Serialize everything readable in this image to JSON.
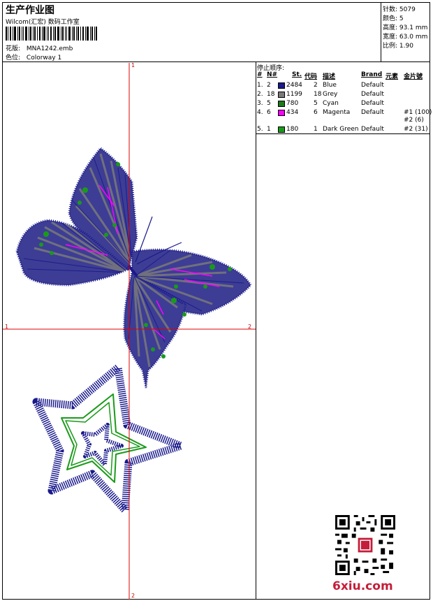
{
  "header": {
    "title": "生产作业图",
    "subtitle": "Wilcom(汇宏) 数码工作室",
    "design_label": "花版:",
    "design_value": "MNA1242.emb",
    "colorway_label": "色位:",
    "colorway_value": "Colorway 1"
  },
  "stats": [
    {
      "label": "针数:",
      "value": "5079"
    },
    {
      "label": "颜色:",
      "value": "5"
    },
    {
      "label": "高度:",
      "value": "93.1 mm"
    },
    {
      "label": "宽度:",
      "value": "63.0 mm"
    },
    {
      "label": "比例:",
      "value": "1.90"
    }
  ],
  "sequence": {
    "title": "停止顺序:",
    "headers": [
      "#",
      "N#",
      "St.",
      "代码",
      "描述",
      "Brand",
      "元素",
      "金片號"
    ],
    "rows": [
      {
        "no": "1.",
        "n": "2",
        "st": "2484",
        "code": "2",
        "desc": "Blue",
        "brand": "Default",
        "elem": "",
        "color": "#1a1a8c"
      },
      {
        "no": "2.",
        "n": "18",
        "st": "1199",
        "code": "18",
        "desc": "Grey",
        "brand": "Default",
        "elem": "",
        "color": "#7a7a7a"
      },
      {
        "no": "3.",
        "n": "5",
        "st": "780",
        "code": "5",
        "desc": "Cyan",
        "brand": "Default",
        "elem": "",
        "color": "#1b7a1b"
      },
      {
        "no": "4.",
        "n": "6",
        "st": "434",
        "code": "6",
        "desc": "Magenta",
        "brand": "Default",
        "elem": "#1 (100)",
        "elem2": "#2 (6)",
        "color": "#ff00ff"
      },
      {
        "no": "5.",
        "n": "1",
        "st": "180",
        "code": "1",
        "desc": "Dark Green",
        "brand": "Default",
        "elem": "#2 (31)",
        "color": "#1a9a1a"
      }
    ]
  },
  "axes": {
    "top": "1",
    "bottom": "2",
    "left": "1",
    "right": "2"
  },
  "watermark": {
    "brand_text": "6xiu.com"
  },
  "colors": {
    "blue": "#1a1a8c",
    "grey": "#7a7a7a",
    "magenta": "#ff00ff",
    "green": "#1a9a1a",
    "axis": "#e00000"
  }
}
